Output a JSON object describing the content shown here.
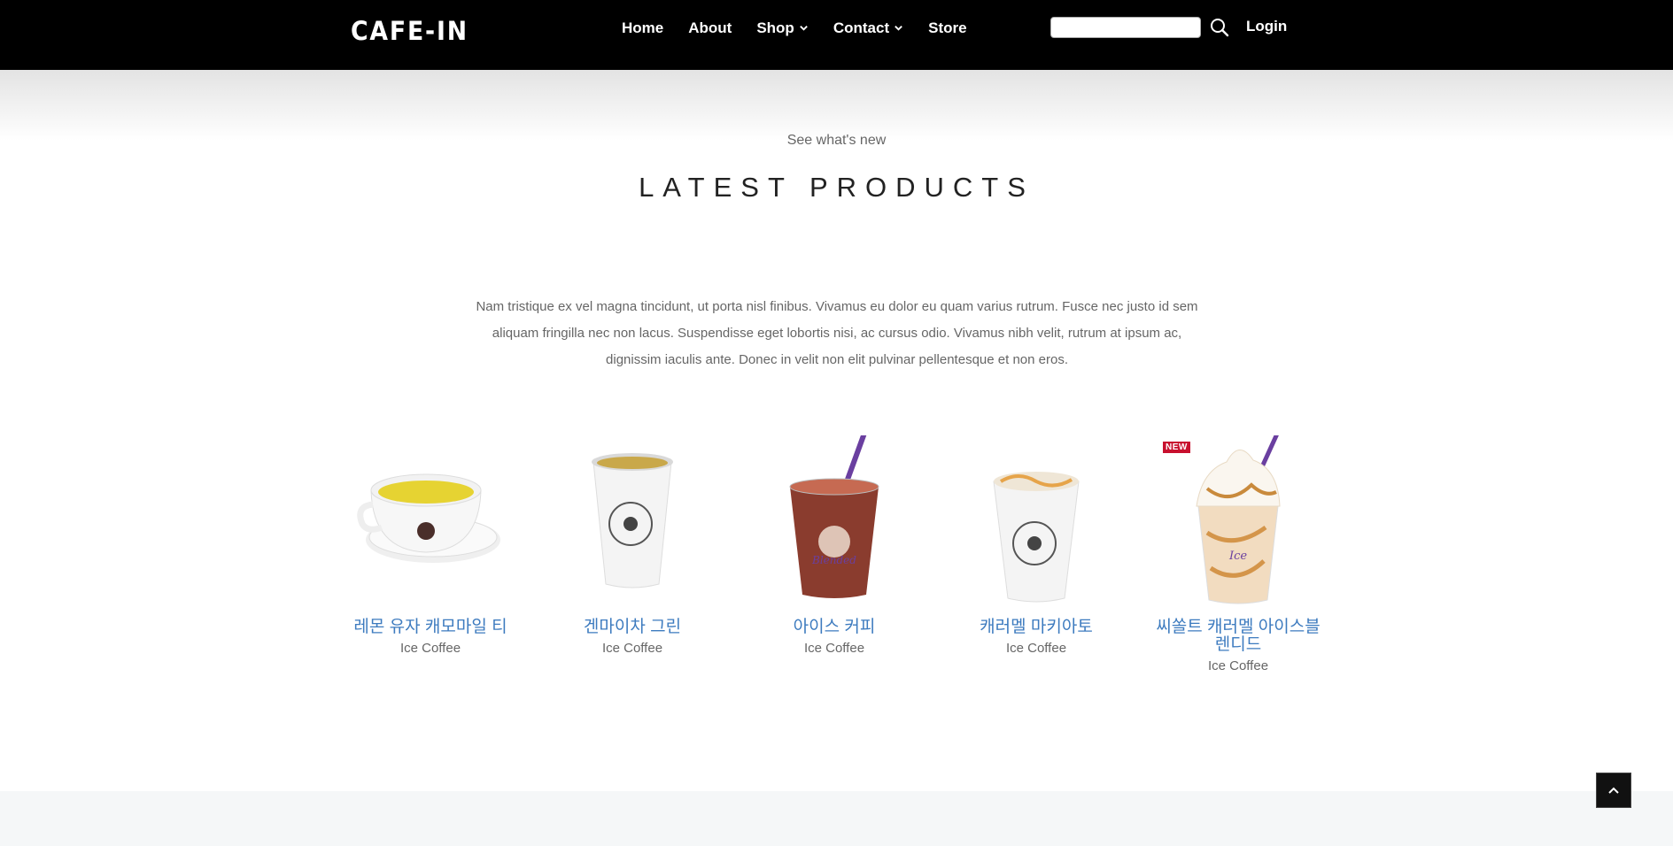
{
  "header": {
    "logo": "CAFE-IN",
    "nav": [
      {
        "label": "Home",
        "has_menu": false
      },
      {
        "label": "About",
        "has_menu": false
      },
      {
        "label": "Shop",
        "has_menu": true
      },
      {
        "label": "Contact",
        "has_menu": true
      },
      {
        "label": "Store",
        "has_menu": false
      }
    ],
    "search": {
      "value": "",
      "placeholder": ""
    },
    "login_label": "Login"
  },
  "section": {
    "kicker": "See what's new",
    "title": "LATEST PRODUCTS",
    "intro": "Nam tristique ex vel magna tincidunt, ut porta nisl finibus. Vivamus eu dolor eu quam varius rutrum. Fusce nec justo id sem aliquam fringilla nec non lacus. Suspendisse eget lobortis nisi, ac cursus odio. Vivamus nibh velit, rutrum at ipsum ac, dignissim iaculis ante. Donec in velit non elit pulvinar pellentesque et non eros."
  },
  "products": [
    {
      "name": "레몬 유자 캐모마일 티",
      "category": "Ice Coffee",
      "image": "tea-cup"
    },
    {
      "name": "겐마이차 그린",
      "category": "Ice Coffee",
      "image": "paper-cup-tea"
    },
    {
      "name": "아이스 커피",
      "category": "Ice Coffee",
      "image": "iced-coffee-cup",
      "badge": ""
    },
    {
      "name": "캐러멜 마키아토",
      "category": "Ice Coffee",
      "image": "paper-cup-caramel"
    },
    {
      "name": "씨쏠트 캐러멜 아이스블렌디드",
      "category": "Ice Coffee",
      "image": "ice-blended-cup",
      "badge": "NEW"
    }
  ],
  "colors": {
    "header_bg": "#000000",
    "accent_link": "#3d7bbf",
    "badge": "#c8102e"
  },
  "icons": {
    "search": "search-icon",
    "back_to_top": "chevron-up-icon"
  }
}
